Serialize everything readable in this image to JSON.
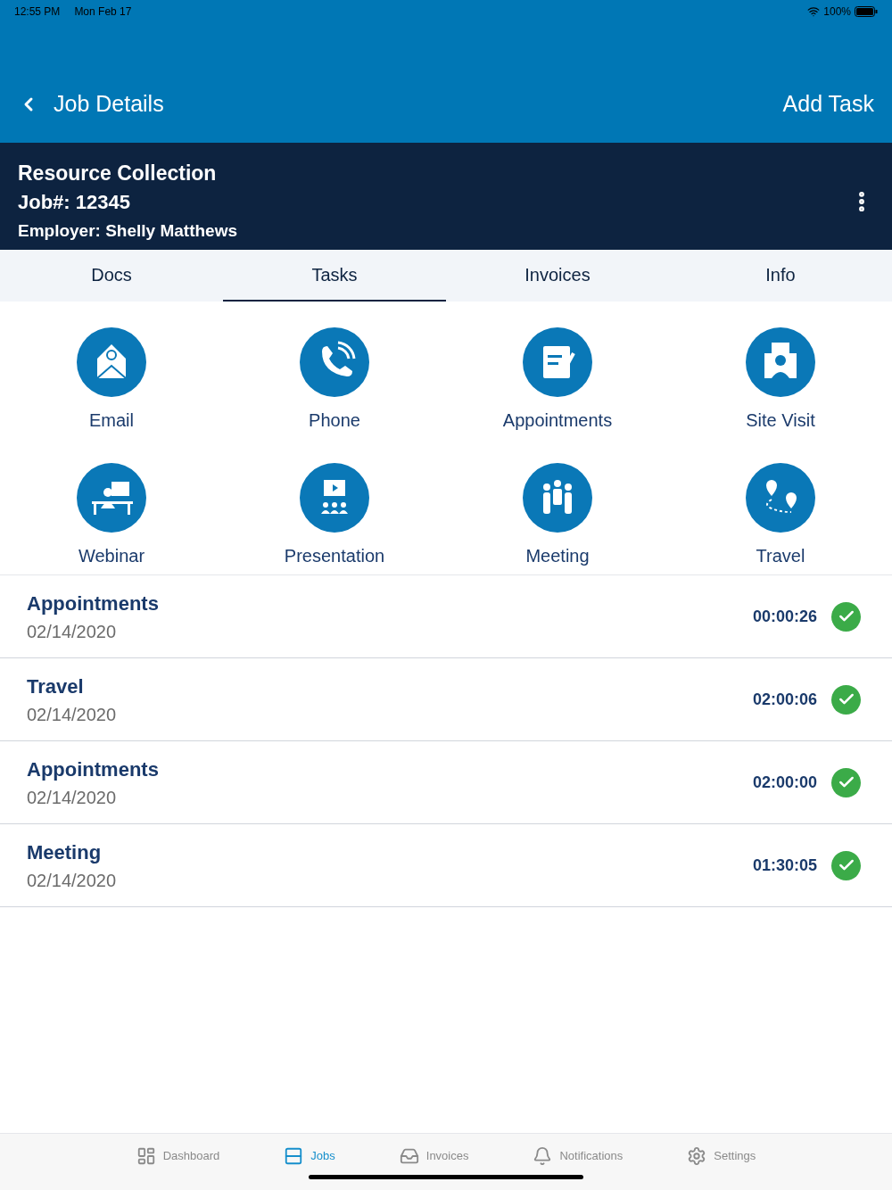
{
  "status_bar": {
    "time": "12:55 PM",
    "date": "Mon Feb 17",
    "battery": "100%"
  },
  "nav": {
    "title": "Job Details",
    "action": "Add Task"
  },
  "job": {
    "name": "Resource Collection",
    "number": "Job#: 12345",
    "employer": "Employer: Shelly Matthews"
  },
  "tabs": [
    {
      "label": "Docs",
      "selected": false
    },
    {
      "label": "Tasks",
      "selected": true
    },
    {
      "label": "Invoices",
      "selected": false
    },
    {
      "label": "Info",
      "selected": false
    }
  ],
  "task_types": [
    {
      "kind": "email",
      "label": "Email"
    },
    {
      "kind": "phone",
      "label": "Phone"
    },
    {
      "kind": "appointments",
      "label": "Appointments"
    },
    {
      "kind": "site",
      "label": "Site Visit"
    },
    {
      "kind": "webinar",
      "label": "Webinar"
    },
    {
      "kind": "presentation",
      "label": "Presentation"
    },
    {
      "kind": "meeting",
      "label": "Meeting"
    },
    {
      "kind": "travel",
      "label": "Travel"
    }
  ],
  "tasks": [
    {
      "name": "Appointments",
      "date": "02/14/2020",
      "duration": "00:00:26",
      "done": true
    },
    {
      "name": "Travel",
      "date": "02/14/2020",
      "duration": "02:00:06",
      "done": true
    },
    {
      "name": "Appointments",
      "date": "02/14/2020",
      "duration": "02:00:00",
      "done": true
    },
    {
      "name": "Meeting",
      "date": "02/14/2020",
      "duration": "01:30:05",
      "done": true
    }
  ],
  "bottom_tabs": [
    {
      "kind": "dashboard",
      "label": "Dashboard",
      "selected": false
    },
    {
      "kind": "jobs",
      "label": "Jobs",
      "selected": true
    },
    {
      "kind": "invoices",
      "label": "Invoices",
      "selected": false
    },
    {
      "kind": "notifications",
      "label": "Notifications",
      "selected": false
    },
    {
      "kind": "settings",
      "label": "Settings",
      "selected": false
    }
  ]
}
